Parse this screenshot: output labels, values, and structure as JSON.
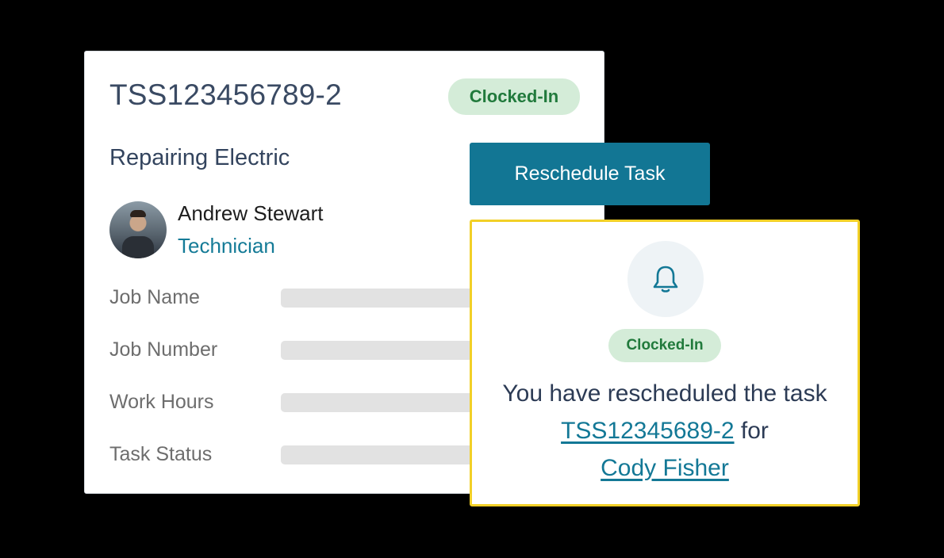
{
  "task_card": {
    "task_id": "TSS123456789-2",
    "status_badge": "Clocked-In",
    "job_title": "Repairing Electric",
    "assignee": {
      "name": "Andrew Stewart",
      "role": "Technician"
    },
    "fields": [
      {
        "label": "Job Name"
      },
      {
        "label": "Job Number"
      },
      {
        "label": "Work Hours"
      },
      {
        "label": "Task Status"
      }
    ]
  },
  "reschedule_button": {
    "label": "Reschedule Task"
  },
  "notification": {
    "icon": "bell-icon",
    "status_badge": "Clocked-In",
    "message_part1": "You have rescheduled the task",
    "task_link": "TSS12345689-2",
    "message_part2": "for",
    "person_link": "Cody Fisher"
  },
  "colors": {
    "accent": "#127694",
    "badge_bg": "#d4ecd8",
    "badge_text": "#217a3c",
    "notification_border": "#f2d027"
  }
}
